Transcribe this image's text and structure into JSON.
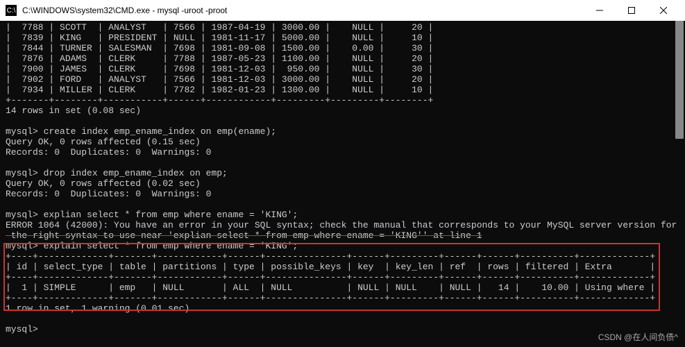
{
  "titlebar": {
    "icon": "C:\\",
    "text": "C:\\WINDOWS\\system32\\CMD.exe - mysql  -uroot -proot"
  },
  "emp_rows": [
    [
      "7788",
      "SCOTT",
      "ANALYST",
      "7566",
      "1987-04-19",
      "3000.00",
      "NULL",
      "20"
    ],
    [
      "7839",
      "KING",
      "PRESIDENT",
      "NULL",
      "1981-11-17",
      "5000.00",
      "NULL",
      "10"
    ],
    [
      "7844",
      "TURNER",
      "SALESMAN",
      "7698",
      "1981-09-08",
      "1500.00",
      "0.00",
      "30"
    ],
    [
      "7876",
      "ADAMS",
      "CLERK",
      "7788",
      "1987-05-23",
      "1100.00",
      "NULL",
      "20"
    ],
    [
      "7900",
      "JAMES",
      "CLERK",
      "7698",
      "1981-12-03",
      "950.00",
      "NULL",
      "30"
    ],
    [
      "7902",
      "FORD",
      "ANALYST",
      "7566",
      "1981-12-03",
      "3000.00",
      "NULL",
      "20"
    ],
    [
      "7934",
      "MILLER",
      "CLERK",
      "7782",
      "1982-01-23",
      "1300.00",
      "NULL",
      "10"
    ]
  ],
  "emp_sep": "+-------+--------+-----------+------+------------+---------+---------+--------+",
  "emp_footer": "14 rows in set (0.08 sec)",
  "stmt1": {
    "prompt": "mysql> create index emp_ename_index on emp(ename);",
    "r1": "Query OK, 0 rows affected (0.15 sec)",
    "r2": "Records: 0  Duplicates: 0  Warnings: 0"
  },
  "stmt2": {
    "prompt": "mysql> drop index emp_ename_index on emp;",
    "r1": "Query OK, 0 rows affected (0.02 sec)",
    "r2": "Records: 0  Duplicates: 0  Warnings: 0"
  },
  "stmt3": {
    "prompt": "mysql> explian select * from emp where ename = 'KING';",
    "err1": "ERROR 1064 (42000): You have an error in your SQL syntax; check the manual that corresponds to your MySQL server version for",
    "err2": " the right syntax to use near 'explian select * from emp where ename = 'KING'' at line 1"
  },
  "stmt4": {
    "prompt": "mysql> explain select * from emp where ename = 'KING';"
  },
  "explain_sep": "+----+-------------+-------+------------+------+---------------+------+---------+------+------+----------+-------------+",
  "explain_hdr": "| id | select_type | table | partitions | type | possible_keys | key  | key_len | ref  | rows | filtered | Extra       |",
  "explain_row": "|  1 | SIMPLE      | emp   | NULL       | ALL  | NULL          | NULL | NULL    | NULL |   14 |    10.00 | Using where |",
  "explain_footer": "1 row in set, 1 warning (0.01 sec)",
  "final_prompt": "mysql>",
  "watermark": "CSDN @在人间负债^",
  "chart_data": {
    "type": "table",
    "title": "EXPLAIN output",
    "columns": [
      "id",
      "select_type",
      "table",
      "partitions",
      "type",
      "possible_keys",
      "key",
      "key_len",
      "ref",
      "rows",
      "filtered",
      "Extra"
    ],
    "rows": [
      [
        "1",
        "SIMPLE",
        "emp",
        "NULL",
        "ALL",
        "NULL",
        "NULL",
        "NULL",
        "NULL",
        "14",
        "10.00",
        "Using where"
      ]
    ]
  }
}
